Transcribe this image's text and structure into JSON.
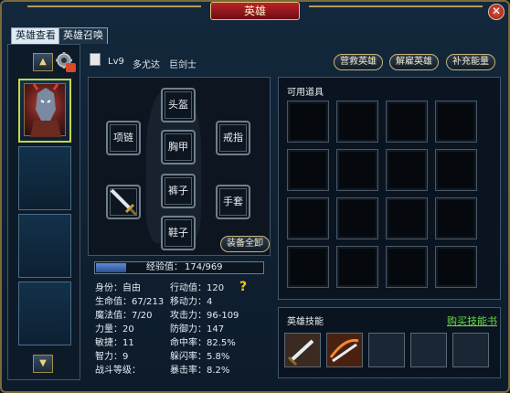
{
  "window": {
    "title": "英雄",
    "close_symbol": "✕"
  },
  "tabs": [
    {
      "label": "英雄查看",
      "active": true
    },
    {
      "label": "英雄召唤",
      "active": false
    }
  ],
  "hero": {
    "level": "Lv9",
    "name": "多尤达",
    "class": "巨剑士"
  },
  "actions": {
    "rescue": "营救英雄",
    "dismiss": "解雇英雄",
    "recharge": "补充能量",
    "equip_all": "装备全卸"
  },
  "equipment": {
    "helmet": "头盔",
    "necklace": "项链",
    "armor": "胸甲",
    "ring": "戒指",
    "pants": "裤子",
    "gloves": "手套",
    "shoes": "鞋子"
  },
  "experience": {
    "label": "经验值：",
    "current": 174,
    "max": 969,
    "text": "174/969"
  },
  "stats_left": [
    {
      "label": "身份：",
      "value": "自由"
    },
    {
      "label": "生命值：",
      "value": "67/213"
    },
    {
      "label": "魔法值：",
      "value": "7/20"
    },
    {
      "label": "力量：",
      "value": "20"
    },
    {
      "label": "敏捷：",
      "value": "11"
    },
    {
      "label": "智力：",
      "value": "9"
    },
    {
      "label": "战斗等级：",
      "value": ""
    }
  ],
  "stats_right": [
    {
      "label": "行动值：",
      "value": "120"
    },
    {
      "label": "移动力：",
      "value": "4"
    },
    {
      "label": "攻击力：",
      "value": "96-109"
    },
    {
      "label": "防御力：",
      "value": "147"
    },
    {
      "label": "命中率：",
      "value": "82.5%"
    },
    {
      "label": "躲闪率：",
      "value": "5.8%"
    },
    {
      "label": "暴击率：",
      "value": "8.2%"
    }
  ],
  "help_symbol": "?",
  "inventory": {
    "title": "可用道具"
  },
  "skills": {
    "title": "英雄技能",
    "buy_link": "购买技能书"
  },
  "colors": {
    "accent_gold": "#c9b37a",
    "exp_blue": "#3e6fc0",
    "link_green": "#6ddc45",
    "title_red": "#b8232a"
  },
  "icons": [
    "up-arrow-icon",
    "down-arrow-icon",
    "gear-icon",
    "document-icon",
    "sword-icon",
    "help-icon",
    "close-icon"
  ]
}
